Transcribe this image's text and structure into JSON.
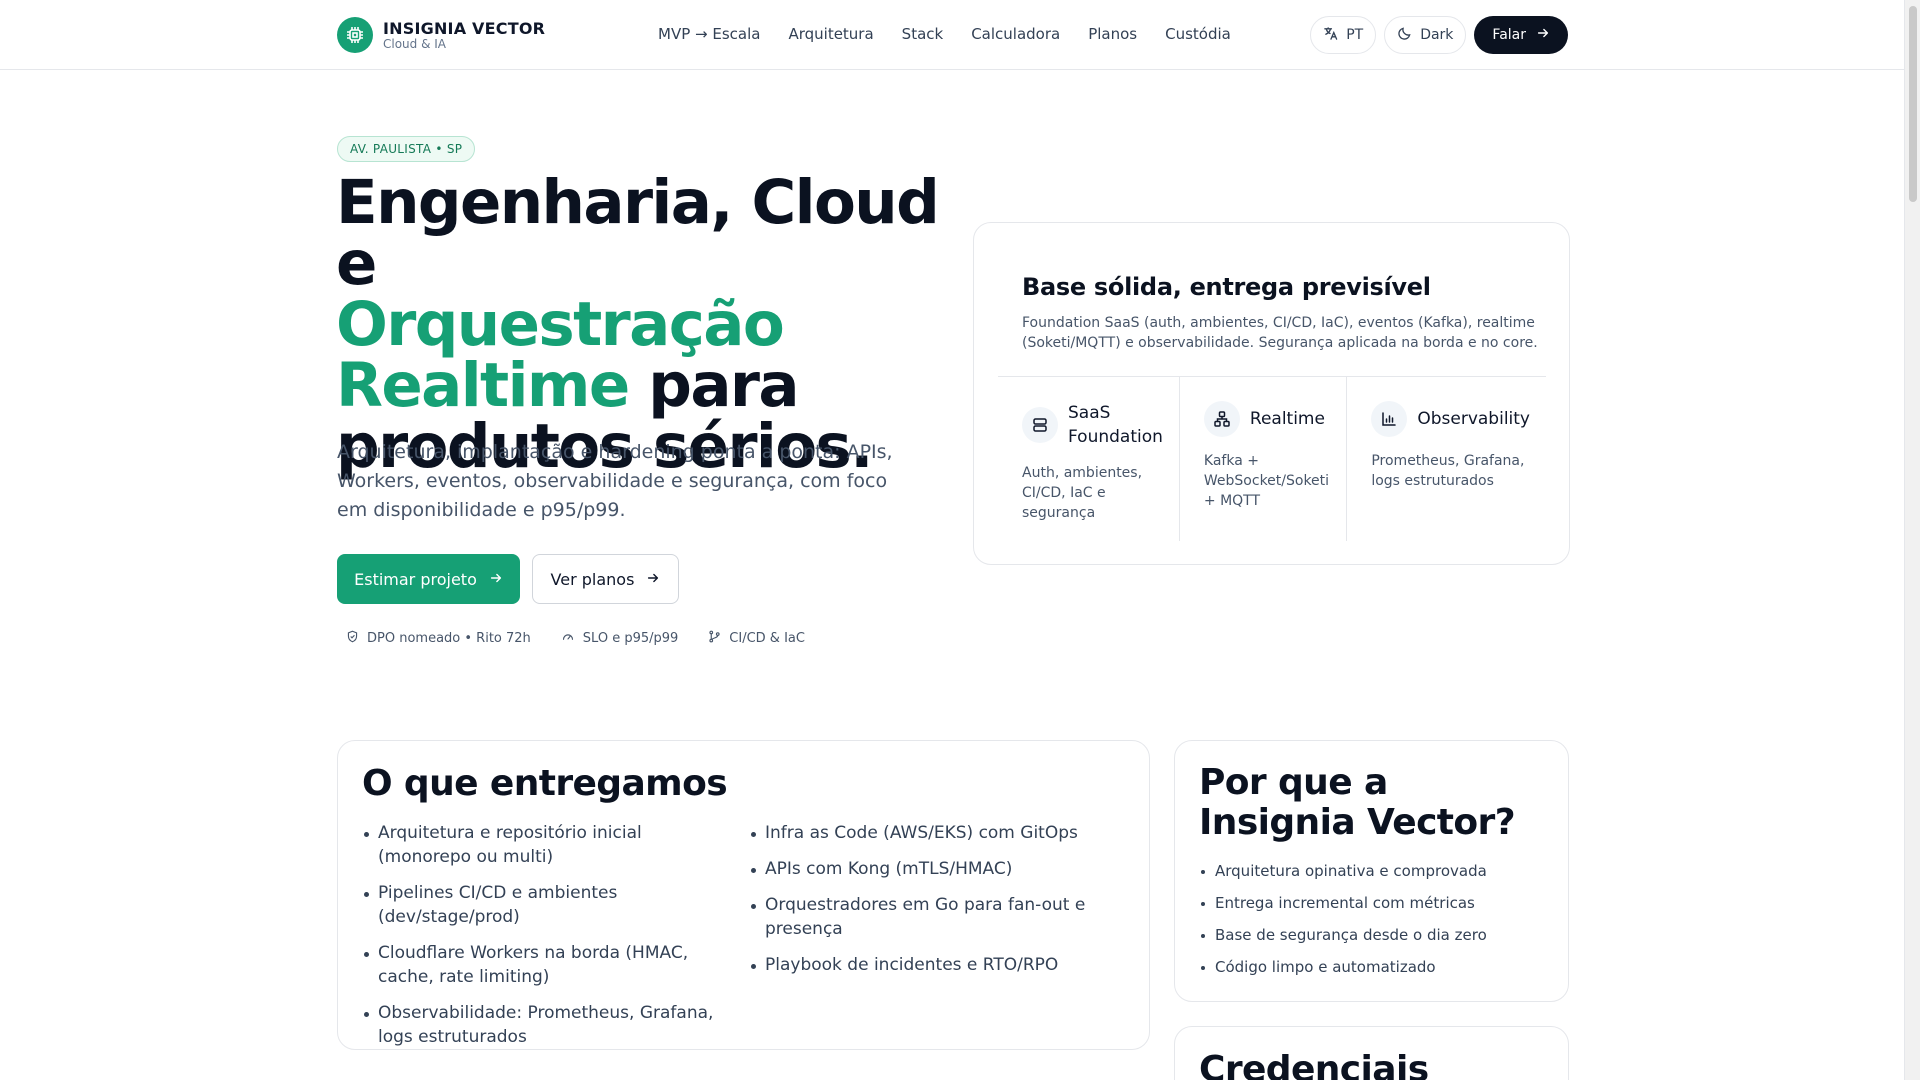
{
  "brand": {
    "name": "INSIGNIA VECTOR",
    "tagline": "Cloud & IA",
    "logo_icon": "chip-icon"
  },
  "nav": {
    "items": [
      "MVP → Escala",
      "Arquitetura",
      "Stack",
      "Calculadora",
      "Planos",
      "Custódia"
    ]
  },
  "header_actions": {
    "language": "PT",
    "theme": "Dark",
    "contact": "Falar"
  },
  "hero": {
    "badge": "AV. PAULISTA • SP",
    "title_line1": "Engenharia, Cloud e",
    "title_green_1": "Orquestração",
    "title_green_2": "Realtime",
    "title_rest_2": " para",
    "title_line4": "produtos sérios.",
    "lede": "Arquitetura, implantação e hardening ponta a ponta: APIs, Workers, eventos, observabilidade e segurança, com foco em disponibilidade e p95/p99.",
    "primary_cta": "Estimar projeto",
    "secondary_cta": "Ver planos",
    "trust": [
      "DPO nomeado • Rito 72h",
      "SLO e p95/p99",
      "CI/CD & IaC"
    ]
  },
  "hero_card": {
    "title": "Base sólida, entrega previsível",
    "description": "Foundation SaaS (auth, ambientes, CI/CD, IaC), eventos (Kafka), realtime (Soketi/MQTT) e observabilidade. Segurança aplicada na borda e no core.",
    "features": [
      {
        "name": "SaaS Foundation",
        "text": "Auth, ambientes, CI/CD, IaC e segurança",
        "icon": "server-icon"
      },
      {
        "name": "Realtime",
        "text": "Kafka + WebSocket/Soketi + MQTT",
        "icon": "network-icon"
      },
      {
        "name": "Observability",
        "text": "Prometheus, Grafana, logs estruturados",
        "icon": "bar-chart-icon"
      }
    ]
  },
  "deliver": {
    "title": "O que entregamos",
    "left": [
      "Arquitetura e repositório inicial (monorepo ou multi)",
      "Pipelines CI/CD e ambientes (dev/stage/prod)",
      "Cloudflare Workers na borda (HMAC, cache, rate limiting)",
      "Observabilidade: Prometheus, Grafana, logs estruturados"
    ],
    "right": [
      "Infra as Code (AWS/EKS) com GitOps",
      "APIs com Kong (mTLS/HMAC)",
      "Orquestradores em Go para fan-out e presença",
      "Playbook de incidentes e RTO/RPO"
    ]
  },
  "why": {
    "title": "Por que a Insignia Vector?",
    "items": [
      "Arquitetura opinativa e comprovada",
      "Entrega incremental com métricas",
      "Base de segurança desde o dia zero",
      "Código limpo e automatizado"
    ]
  },
  "credentials": {
    "title": "Credenciais"
  },
  "colors": {
    "accent": "#16a075",
    "dark": "#0b1220",
    "text": "#475569"
  }
}
